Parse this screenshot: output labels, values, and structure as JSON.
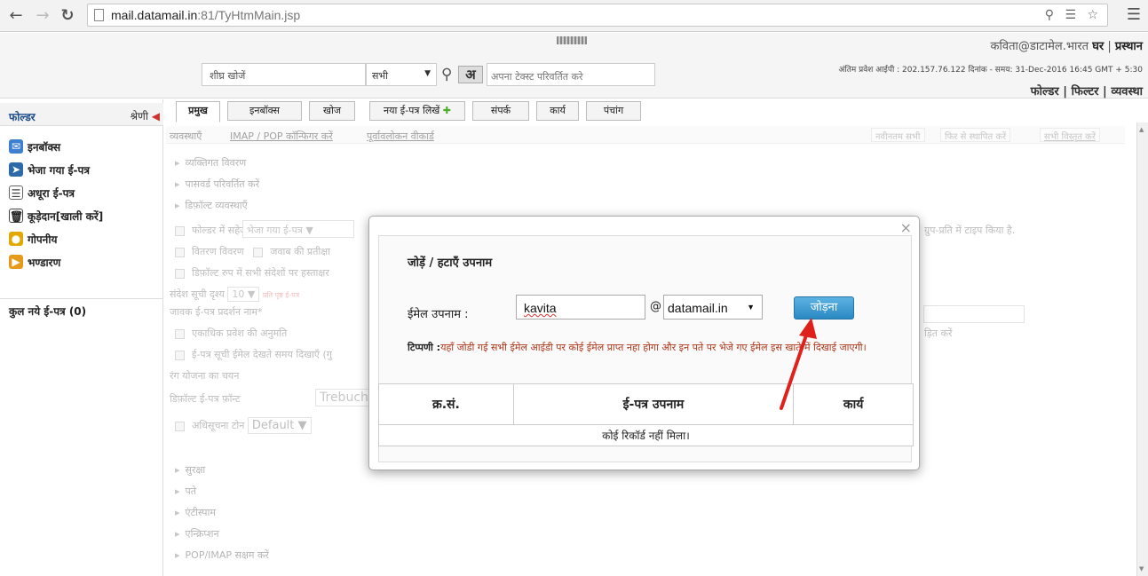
{
  "browser": {
    "url_host": "mail.datamail.in",
    "url_rest": ":81/TyHtmMain.jsp"
  },
  "header": {
    "user_email": "कविता@डाटामेल.भारत",
    "home_link": "घर",
    "logout_link": "प्रस्थान",
    "last_login": "अंतिम प्रवेश आईपी : 202.157.76.122 दिनांक - समय: 31-Dec-2016 16:45 GMT + 5:30",
    "right_links": [
      "फोल्डर",
      "फिल्टर",
      "व्यवस्था"
    ],
    "search_placeholder": "शीघ्र खोजें",
    "search_scope": "सभी",
    "lang_button": "अ",
    "lang_hint": "अपना टेक्स्ट परिवर्तित करे"
  },
  "sidebar": {
    "heading": "फोल्डर",
    "category": "श्रेणी",
    "items": [
      {
        "label": "इनबॉक्स",
        "icon": "inbox-icon",
        "color": "#3d7fd1"
      },
      {
        "label": "भेजा गया ई-पत्र",
        "icon": "sent-icon",
        "color": "#2d6aa8"
      },
      {
        "label": "अधूरा ई-पत्र",
        "icon": "draft-icon",
        "color": "#666666"
      },
      {
        "label": "कूड़ेदान[खाली करें]",
        "icon": "trash-icon",
        "color": "#444444"
      },
      {
        "label": "गोपनीय",
        "icon": "lock-icon",
        "color": "#e0a800"
      },
      {
        "label": "भण्डारण",
        "icon": "folder-icon",
        "color": "#e69a1c"
      }
    ],
    "total": "कुल नये ई-पत्र (0)"
  },
  "tabs": [
    "प्रमुख",
    "इनबॉक्स",
    "खोज",
    "नया ई-पत्र लिखें",
    "संपर्क",
    "कार्य",
    "पंचांग"
  ],
  "settings": {
    "label": "व्यवस्थाएँ",
    "links": [
      "IMAP / POP कॉन्फिगर करें",
      "पूर्वावलोकन वीकार्ड"
    ],
    "right_buttons": [
      "नवीनतम सभी",
      "फिर से स्थापित करें",
      "सभी विस्तृत करें"
    ],
    "sections_top": [
      "व्यक्तिगत विवरण",
      "पासवर्ड परिवर्तित करें",
      "डिफ़ॉल्ट व्यवस्थाएँ"
    ],
    "options": [
      "फोल्डर में सहेजें",
      "वितरण विवरण",
      "डिफ़ॉल्ट रुप में सभी संदेशों पर हस्ताक्षर",
      "संदेश सूची दृश्य",
      "जावक ई-पत्र प्रदर्शन नाम*",
      "एकाधिक प्रवेश की अनुमति",
      "ई-पत्र सूची ईमेल देखते समय दिखाएँ (गु",
      "रंग योजना का चयन",
      "डिफ़ॉल्ट ई-पत्र फ़ॉन्ट",
      "अधिसूचना टोन"
    ],
    "sent_folder_value": "भेजा गया ई-पत्र",
    "reply_wait": "जवाब की प्रतीक्षा",
    "list_count": "10",
    "per_page": "प्रति पृष्ठ ई-पत्र",
    "font_value": "Trebuch",
    "tone_value": "Default",
    "right_text_1": "ग्रुप-प्रति में टाइप किया है.",
    "right_text_2": "ड़ित करें",
    "sections_bottom": [
      "सुरक्षा",
      "पते",
      "एंटीस्पाम",
      "एन्क्रिप्शन",
      "POP/IMAP सक्षम करें"
    ]
  },
  "modal": {
    "title": "जोड़ें / हटाएँ उपनाम",
    "alias_label": "ईमेल उपनाम :",
    "alias_value": "kavita",
    "at": "@",
    "domain": "datamail.in",
    "add_button": "जोड़ना",
    "close": "×",
    "note_label": "टिप्पणी :",
    "note_text": "यहाँ जोडी गई सभी ईमेल आईडी पर कोई ईमेल प्राप्त नहा होगा और इन पते पर भेजे गए ईमेल इस खाते में दिखाई जाएगी।",
    "table_headers": [
      "क्र.सं.",
      "ई-पत्र उपनाम",
      "कार्य"
    ],
    "empty_text": "कोई रिकॉर्ड नहीं मिला।"
  },
  "colors": {
    "accent_button": "#2a88c2",
    "note_red": "#b0361a",
    "arrow_red": "#e0201a"
  }
}
